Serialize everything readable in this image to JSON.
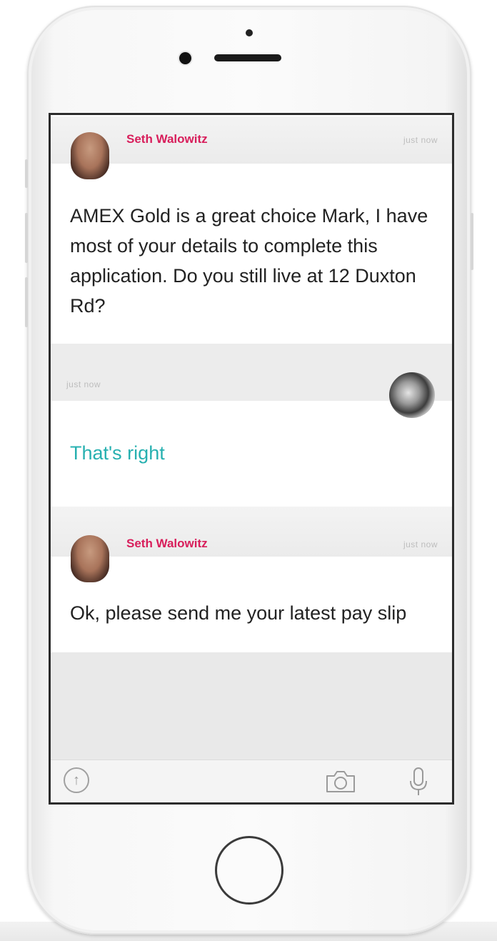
{
  "messages": [
    {
      "sender": "Seth Walowitz",
      "time": "just now",
      "lines": [
        "AMEX Gold is a great choice Mark, I have",
        "most of your details to complete this",
        "application. Do you still live at 12 Duxton",
        "Rd?"
      ],
      "direction": "incoming",
      "avatar_icon": "agent-avatar"
    },
    {
      "time": "just now",
      "lines": [
        "That's right"
      ],
      "direction": "outgoing",
      "avatar_icon": "user-avatar"
    },
    {
      "sender": "Seth Walowitz",
      "time": "just now",
      "lines": [
        "Ok, please send me your latest pay slip"
      ],
      "direction": "incoming",
      "avatar_icon": "agent-avatar"
    }
  ],
  "toolbar": {
    "upload_icon": "upload-icon",
    "upload_glyph": "↑",
    "camera_icon": "camera-icon",
    "mic_icon": "microphone-icon"
  },
  "colors": {
    "sender": "#d81e5b",
    "outgoing_text": "#27b0b0",
    "message_text": "#222222",
    "header_background": "#ececec"
  }
}
